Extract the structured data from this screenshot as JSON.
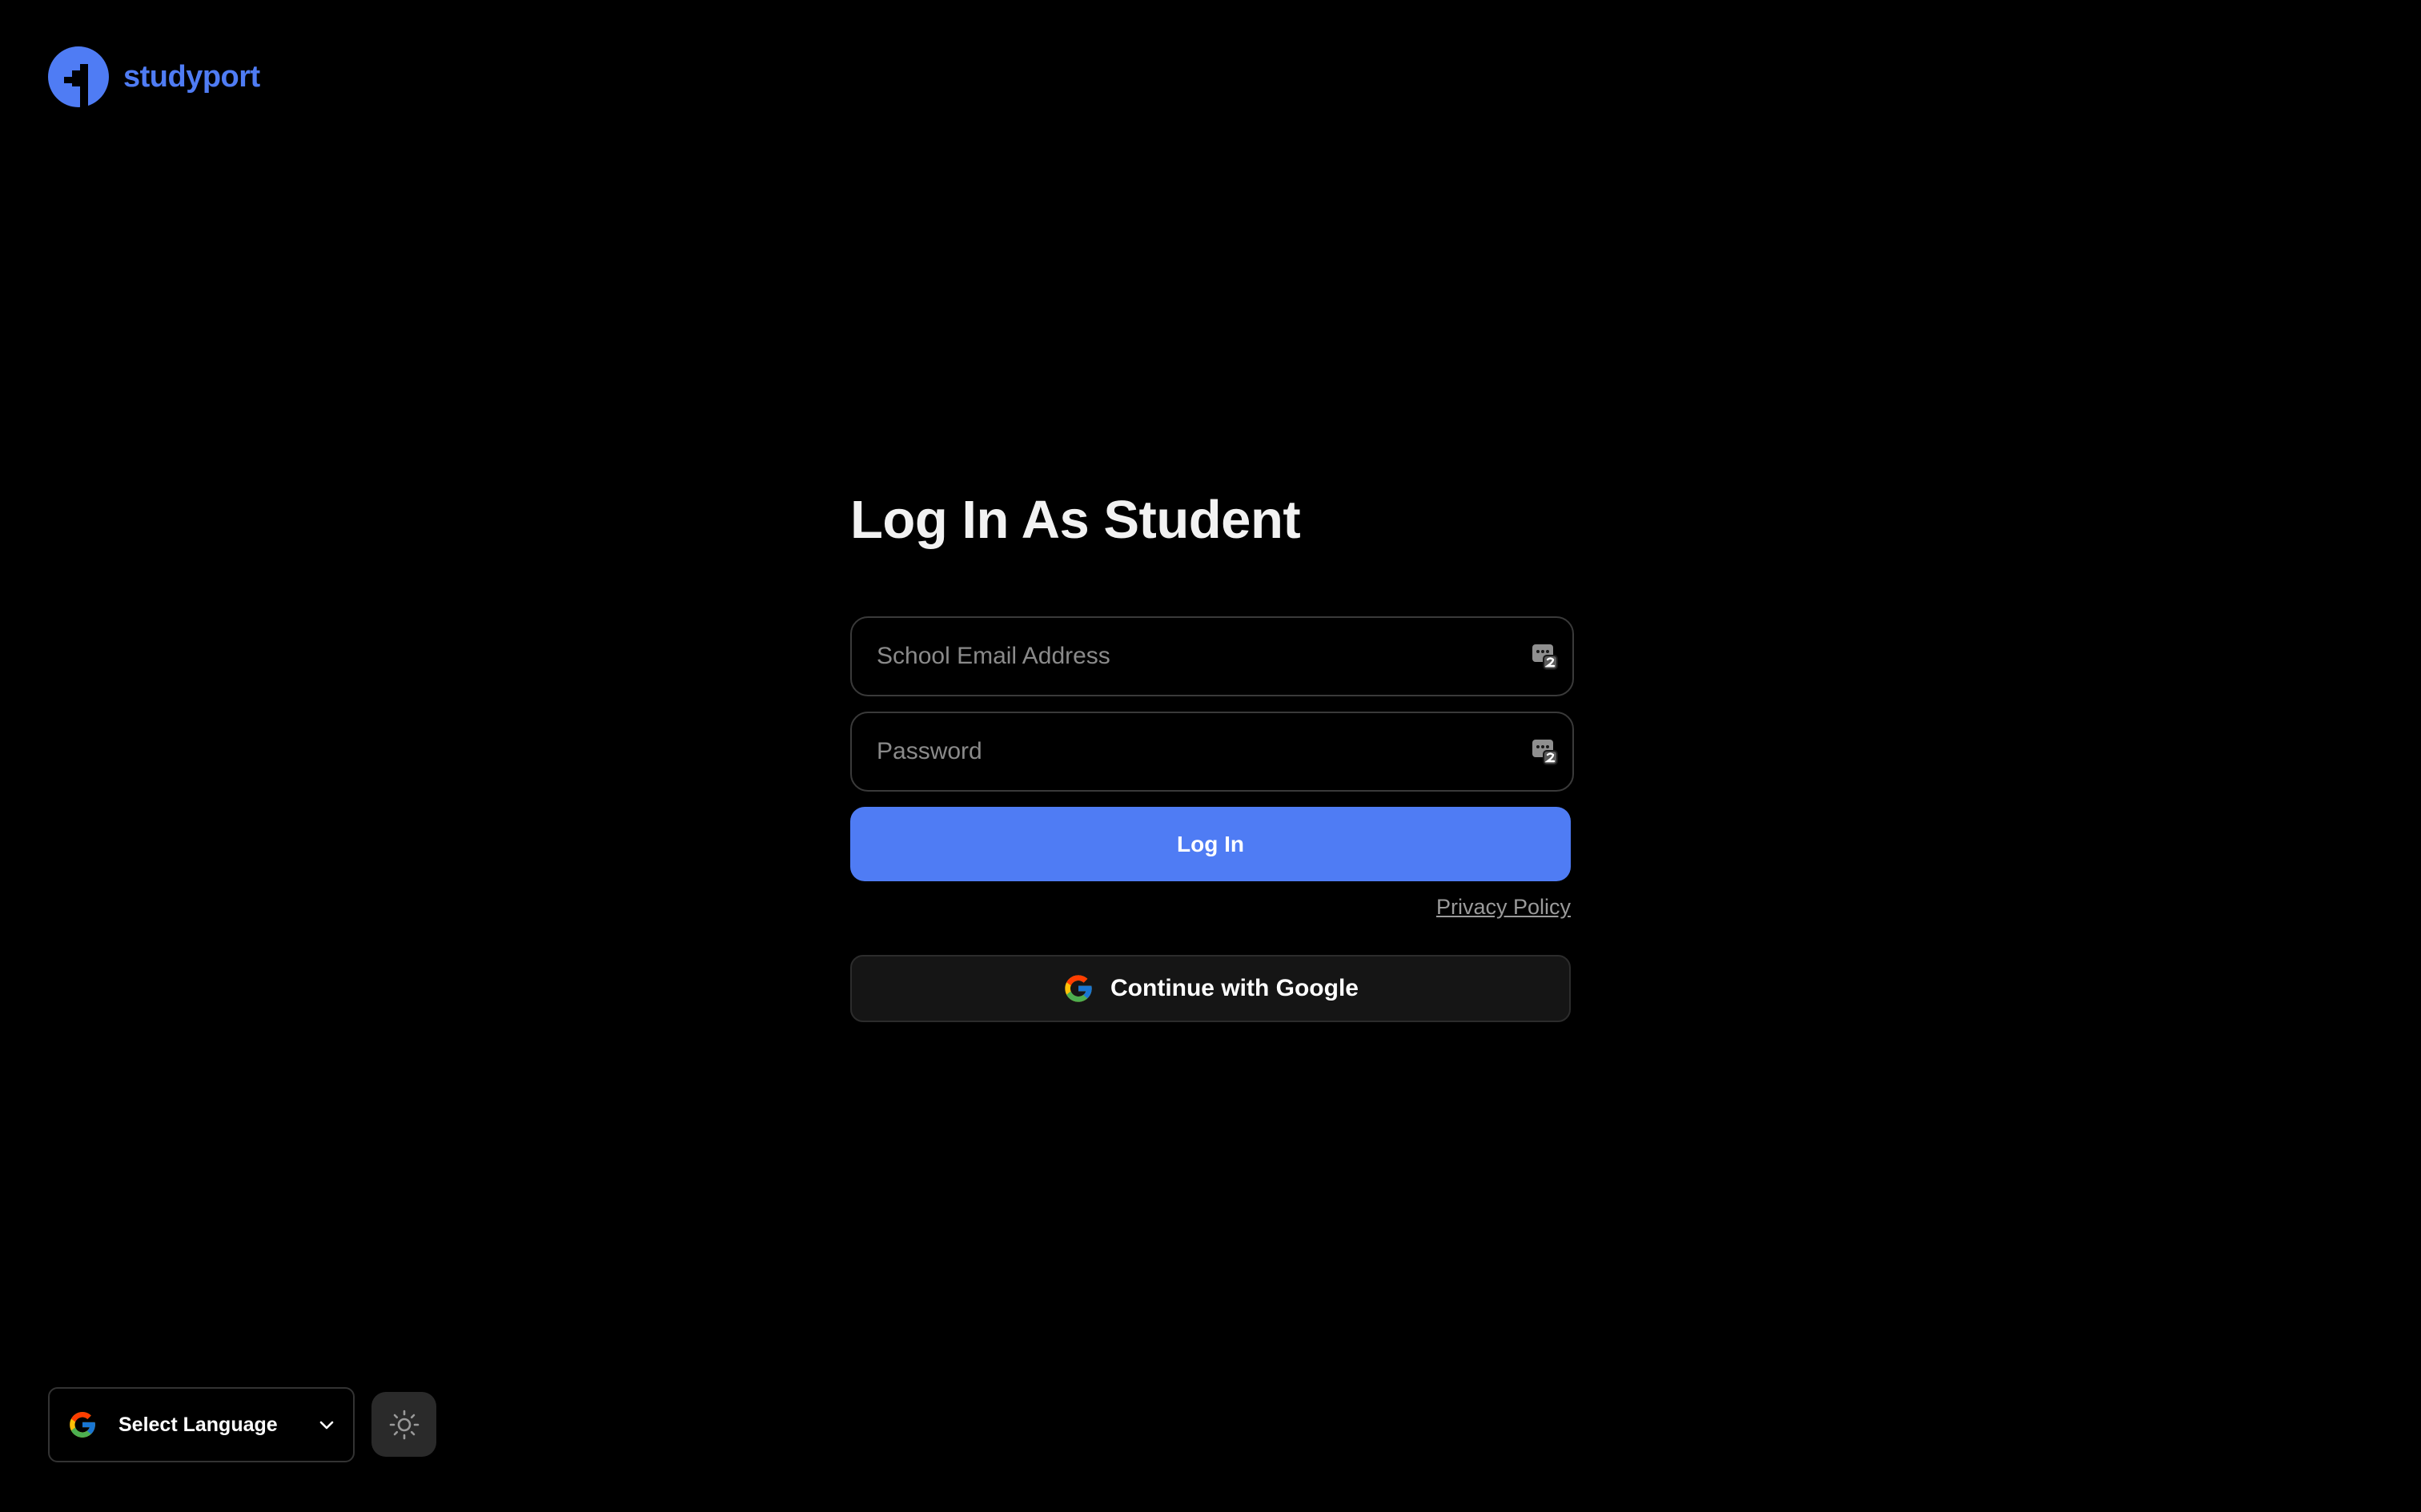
{
  "brand": {
    "name": "studyport",
    "color": "#4f7cf4",
    "logo_icon": "studyport-logo-icon"
  },
  "login": {
    "title": "Log In As Student",
    "email_placeholder": "School Email Address",
    "email_value": "",
    "password_placeholder": "Password",
    "password_value": "",
    "field_icon": "password-manager-icon",
    "submit_label": "Log In",
    "privacy_label": "Privacy Policy",
    "google_label": "Continue with Google",
    "google_icon": "google-g-icon"
  },
  "footer": {
    "language_label": "Select Language",
    "language_icon": "google-g-icon",
    "language_chevron": "chevron-down-icon",
    "theme_icon": "sun-icon"
  },
  "colors": {
    "background": "#000000",
    "accent": "#4f7cf4",
    "surface": "#151515"
  }
}
